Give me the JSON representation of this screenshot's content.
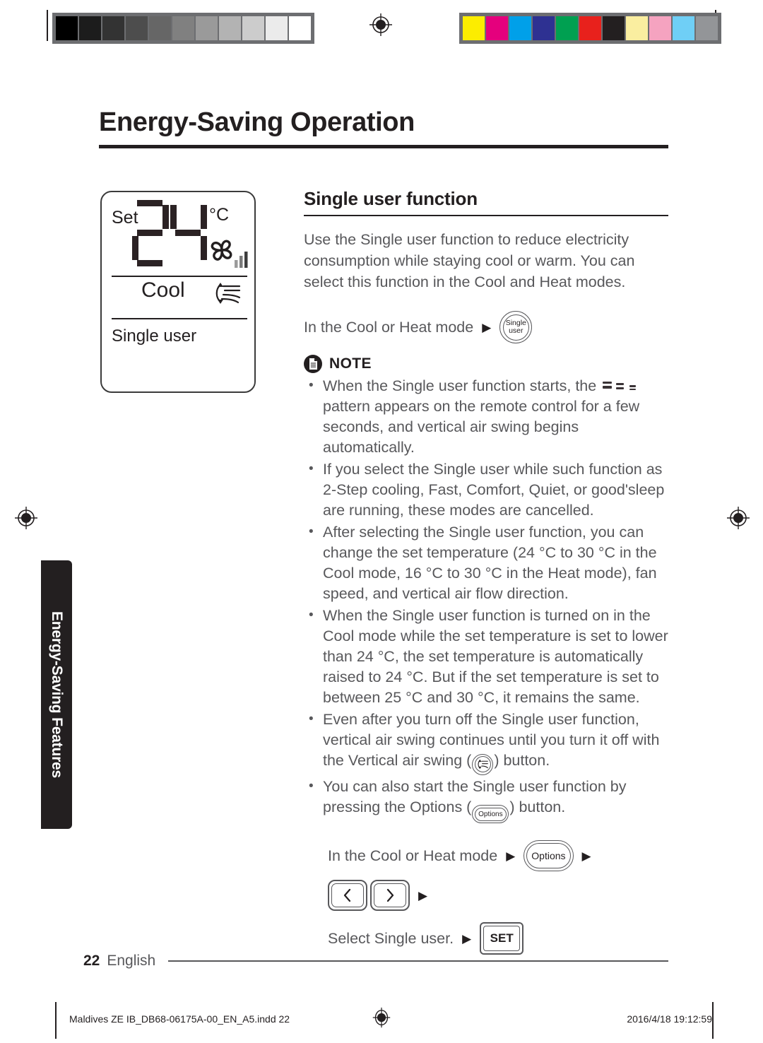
{
  "print_marks": {
    "gray_swatches": [
      "#000000",
      "#1c1c1c",
      "#333333",
      "#4d4d4d",
      "#666666",
      "#808080",
      "#9a9a9a",
      "#b3b3b3",
      "#cccccc",
      "#ebebeb",
      "#ffffff"
    ],
    "color_swatches": [
      "#fced00",
      "#e5007d",
      "#00a0e9",
      "#2e3192",
      "#00a051",
      "#e8211c",
      "#231f20",
      "#faeea0",
      "#f5a3c0",
      "#6fcff6",
      "#939598"
    ],
    "registration_icon": "registration-target-icon"
  },
  "header": {
    "title": "Energy-Saving Operation"
  },
  "lcd": {
    "set_label": "Set",
    "temperature": "24",
    "unit": "°C",
    "mode": "Cool",
    "function": "Single user",
    "fan_icon": "fan-pinwheel-icon",
    "fan_bars": 3,
    "swing_icon": "vertical-air-swing-icon"
  },
  "main": {
    "heading": "Single user function",
    "intro": "Use the Single user function to reduce electricity consumption while staying cool or warm. You can select this function in the Cool and Heat modes.",
    "quick_step": {
      "text": "In the Cool or Heat mode",
      "arrow": "▶",
      "key_line1": "Single",
      "key_line2": "user"
    },
    "note": {
      "icon": "note-document-icon",
      "label": "NOTE",
      "items": [
        {
          "type": "pattern",
          "before": "When the Single user function starts, the",
          "pattern_icon": "dash-pattern-icon",
          "after": "pattern appears on the remote control for a few seconds, and vertical air swing begins automatically."
        },
        {
          "type": "plain",
          "text": "If you select the Single user while such function as 2-Step cooling, Fast, Comfort, Quiet, or good'sleep are running, these modes are cancelled."
        },
        {
          "type": "plain",
          "text": "After selecting the Single user function, you can change the set temperature (24 °C to 30 °C in the Cool mode, 16 °C to 30 °C in the Heat mode), fan speed, and vertical air flow direction."
        },
        {
          "type": "plain",
          "text": "When the Single user function is turned on in the Cool mode while the set temperature is set to lower than 24 °C, the set temperature is automatically raised to 24 °C. But if the set temperature is set to between 25 °C and 30 °C, it remains the same."
        },
        {
          "type": "swingkey",
          "before": "Even after you turn off the Single user function, vertical air swing continues until you turn it off with the Vertical air swing (",
          "key_icon": "vertical-air-swing-button-icon",
          "after": ") button."
        },
        {
          "type": "optionskey",
          "before": "You can also start the Single user function by pressing the Options (",
          "key_label": "Options",
          "after": ") button."
        }
      ]
    },
    "procedure": {
      "line1_text": "In the Cool or Heat mode",
      "arrow": "▶",
      "options_key": "Options",
      "left_arrow_icon": "chevron-left-icon",
      "right_arrow_icon": "chevron-right-icon",
      "line2_text": "Select Single user.",
      "set_key": "SET"
    }
  },
  "side_tab": {
    "label": "Energy-Saving Features"
  },
  "footer": {
    "page_number": "22",
    "language": "English"
  },
  "production": {
    "filename": "Maldives ZE IB_DB68-06175A-00_EN_A5.indd   22",
    "timestamp": "2016/4/18   19:12:59"
  }
}
